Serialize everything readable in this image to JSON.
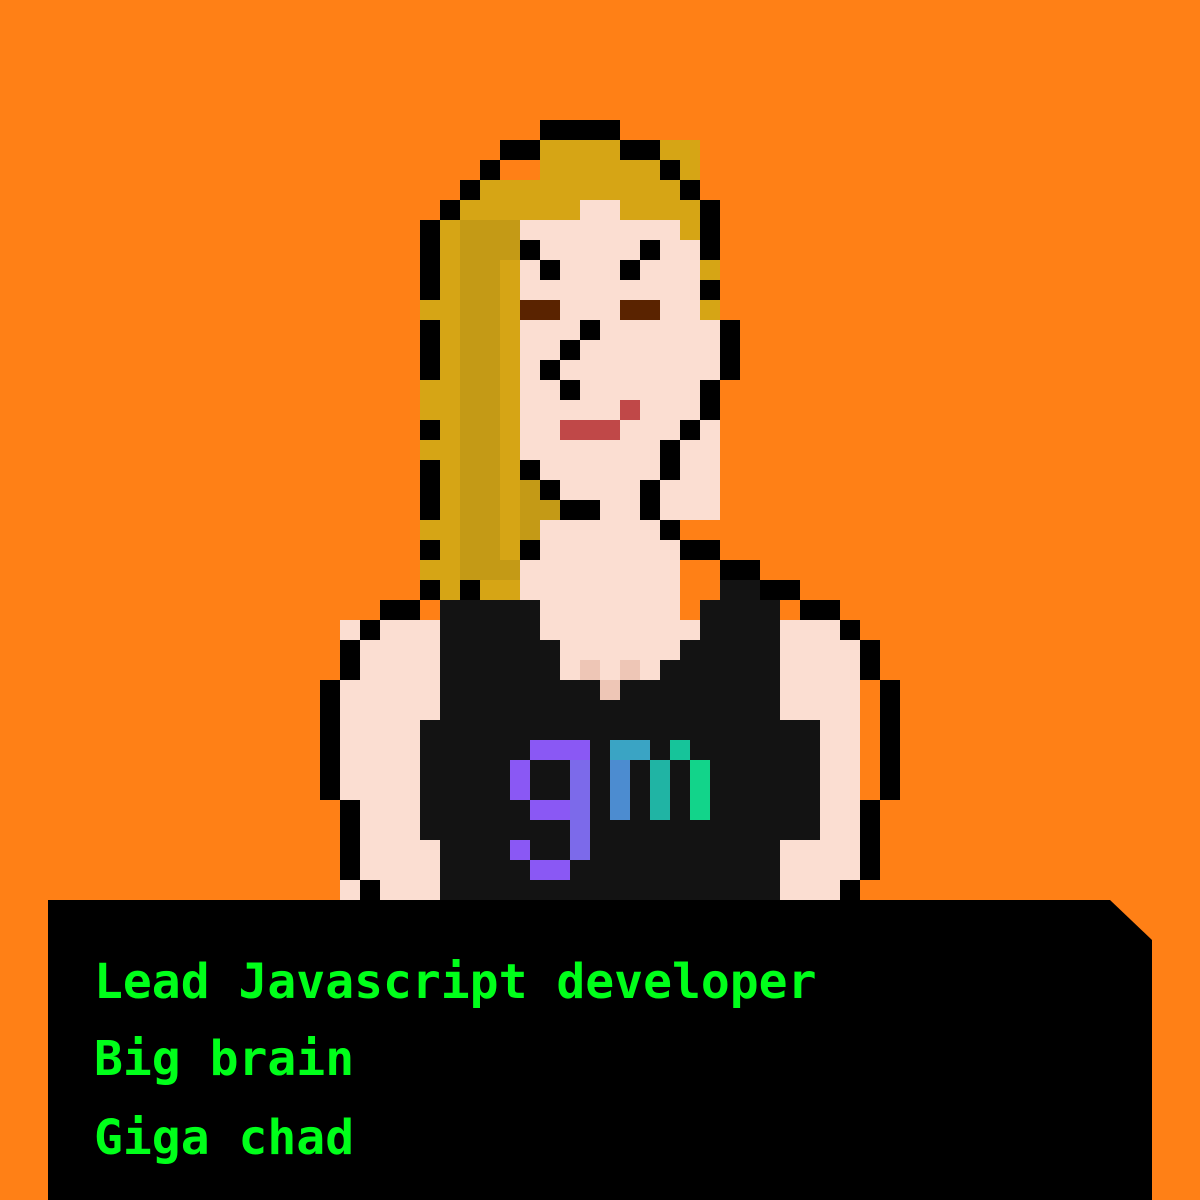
{
  "traits": [
    "Lead Javascript developer",
    "Big brain",
    "Giga chad"
  ],
  "colors": {
    "background": "#FF8016",
    "panel": "#000000",
    "trait_text": "#00FF1A",
    "skin": "#FBDED2",
    "skin_shadow": "#EEC6B6",
    "hair": "#D6A515",
    "hair_shadow": "#C49A16",
    "outline": "#000000",
    "tank_top": "#131313",
    "eyes": "#5A2300",
    "lips": "#C04848",
    "logo_g": "#8A58F4",
    "logo_m_start": "#4C8CD0",
    "logo_m_end": "#12D48A"
  },
  "avatar": {
    "shirt_logo": "gm"
  }
}
